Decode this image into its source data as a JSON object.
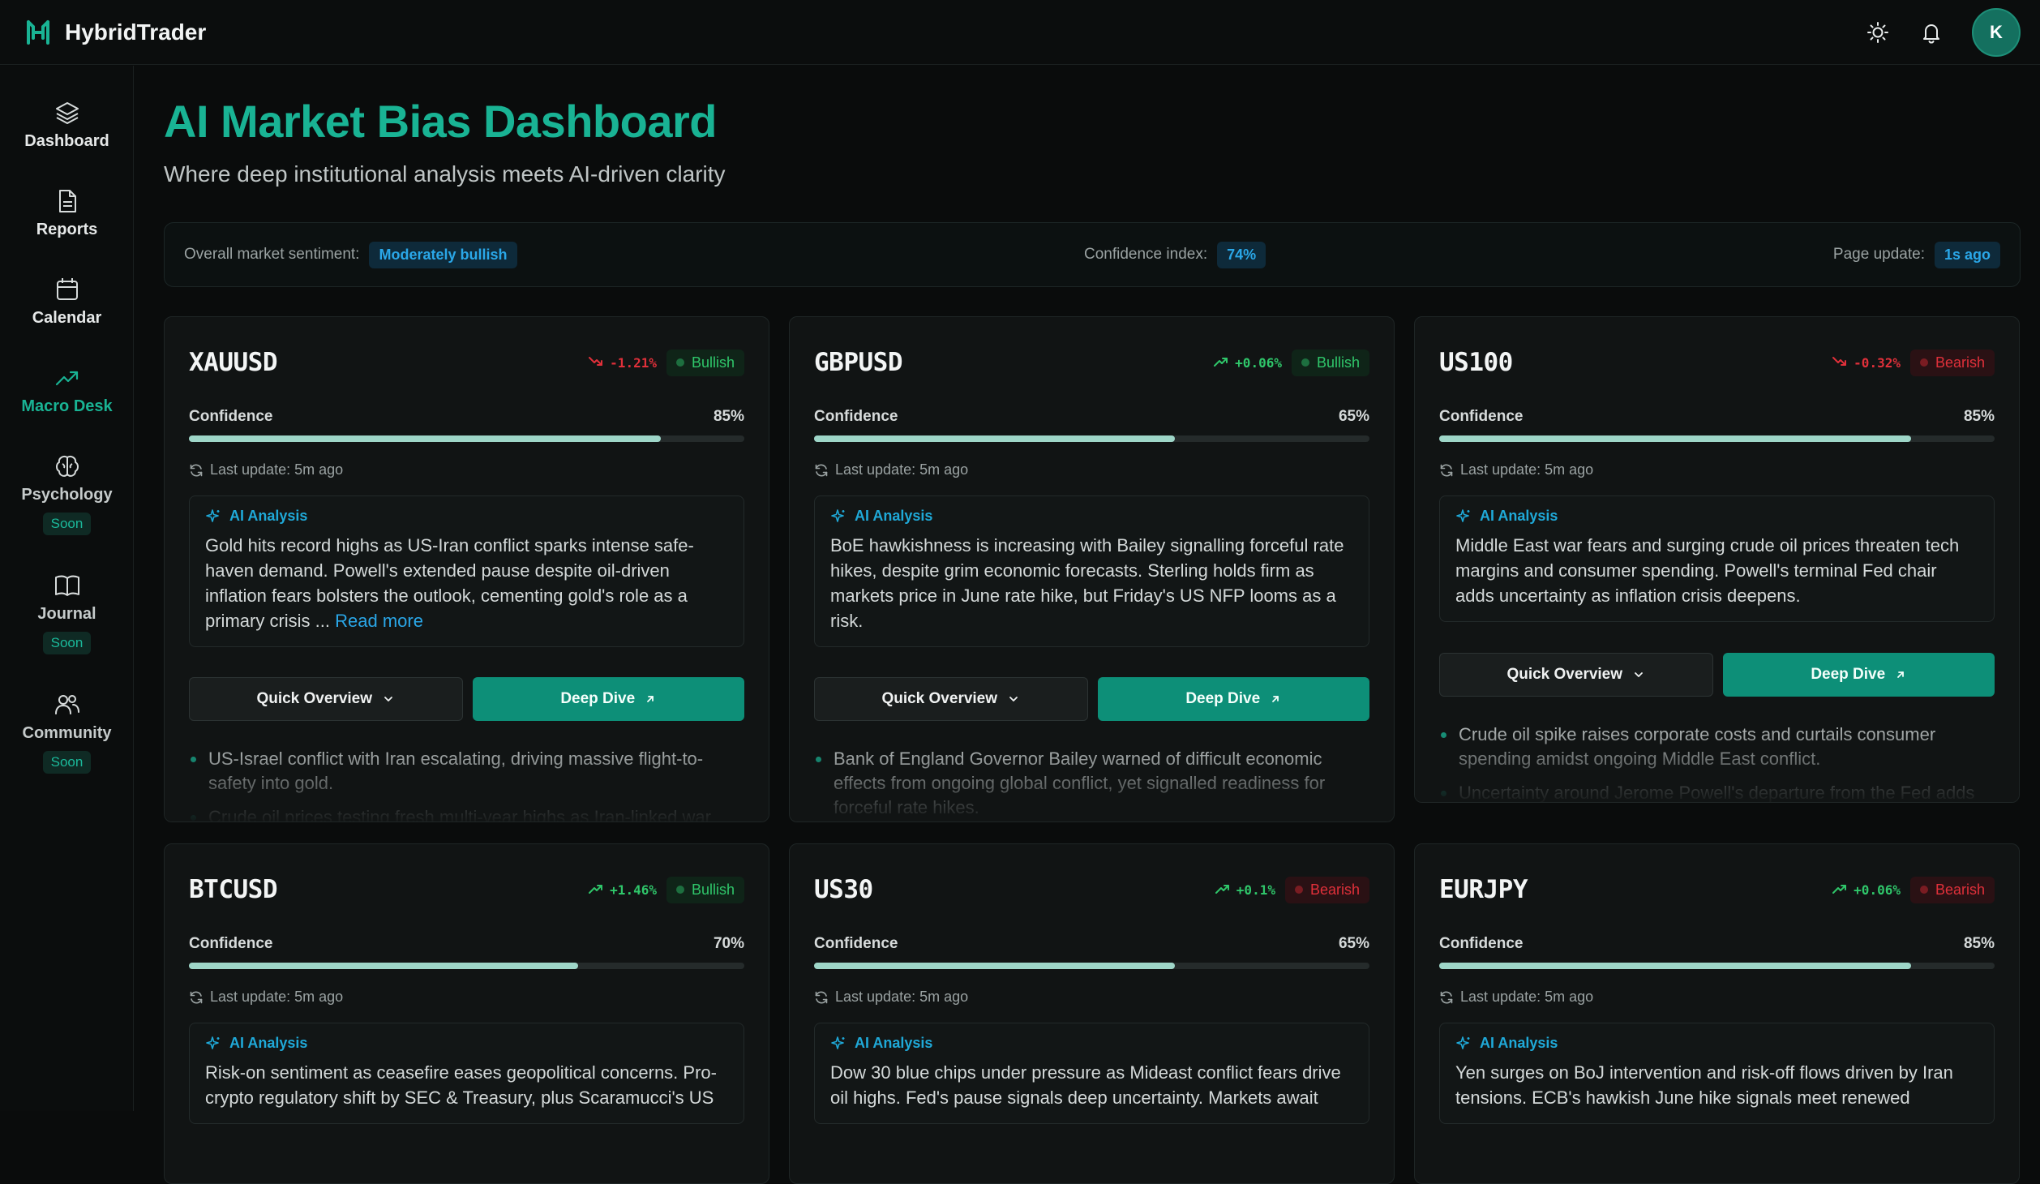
{
  "app": {
    "name": "HybridTrader",
    "avatar_initial": "K"
  },
  "topbar": {
    "icons": [
      "sun-icon",
      "bell-icon"
    ]
  },
  "sidebar": {
    "items": [
      {
        "label": "Dashboard",
        "icon": "layers-icon",
        "active": false,
        "soon": ""
      },
      {
        "label": "Reports",
        "icon": "document-icon",
        "active": false,
        "soon": ""
      },
      {
        "label": "Calendar",
        "icon": "calendar-icon",
        "active": false,
        "soon": ""
      },
      {
        "label": "Macro Desk",
        "icon": "trending-up-icon",
        "active": true,
        "soon": ""
      },
      {
        "label": "Psychology",
        "icon": "brain-icon",
        "active": false,
        "soon": "Soon"
      },
      {
        "label": "Journal",
        "icon": "book-icon",
        "active": false,
        "soon": "Soon"
      },
      {
        "label": "Community",
        "icon": "users-icon",
        "active": false,
        "soon": "Soon"
      }
    ]
  },
  "page": {
    "title": "AI Market Bias Dashboard",
    "subtitle": "Where deep institutional analysis meets AI-driven clarity"
  },
  "summary": {
    "sentiment_label": "Overall market sentiment:",
    "sentiment_value": "Moderately bullish",
    "confidence_label": "Confidence index:",
    "confidence_value": "74%",
    "update_label": "Page update:",
    "update_value": "1s ago"
  },
  "labels": {
    "confidence": "Confidence",
    "ai_analysis": "AI Analysis",
    "quick_overview": "Quick Overview",
    "deep_dive": "Deep Dive",
    "read_more": "Read more"
  },
  "cards": [
    {
      "symbol": "XAUUSD",
      "change": "-1.21%",
      "direction": "down",
      "bias": "Bullish",
      "confidence": 85,
      "confidence_text": "85%",
      "last_update": "Last update: 5m ago",
      "analysis": "Gold hits record highs as US-Iran conflict sparks intense safe-haven demand. Powell's extended pause despite oil-driven inflation fears bolsters the outlook, cementing gold's role as a primary crisis ...",
      "has_read_more": true,
      "bullets": [
        "US-Israel conflict with Iran escalating, driving massive flight-to-safety into gold.",
        "Crude oil prices testing fresh multi-year highs as Iran-linked war"
      ]
    },
    {
      "symbol": "GBPUSD",
      "change": "+0.06%",
      "direction": "up",
      "bias": "Bullish",
      "confidence": 65,
      "confidence_text": "65%",
      "last_update": "Last update: 5m ago",
      "analysis": "BoE hawkishness is increasing with Bailey signalling forceful rate hikes, despite grim economic forecasts. Sterling holds firm as markets price in June rate hike, but Friday's US NFP looms as a risk.",
      "has_read_more": false,
      "bullets": [
        "Bank of England Governor Bailey warned of difficult economic effects from ongoing global conflict, yet signalled readiness for forceful rate hikes."
      ]
    },
    {
      "symbol": "US100",
      "change": "-0.32%",
      "direction": "down",
      "bias": "Bearish",
      "confidence": 85,
      "confidence_text": "85%",
      "last_update": "Last update: 5m ago",
      "analysis": "Middle East war fears and surging crude oil prices threaten tech margins and consumer spending. Powell's terminal Fed chair adds uncertainty as inflation crisis deepens.",
      "has_read_more": false,
      "bullets": [
        "Crude oil spike raises corporate costs and curtails consumer spending amidst ongoing Middle East conflict.",
        "Uncertainty around Jerome Powell's departure from the Fed adds"
      ]
    },
    {
      "symbol": "BTCUSD",
      "change": "+1.46%",
      "direction": "up",
      "bias": "Bullish",
      "confidence": 70,
      "confidence_text": "70%",
      "last_update": "Last update: 5m ago",
      "analysis": "Risk-on sentiment as ceasefire eases geopolitical concerns. Pro-crypto regulatory shift by SEC & Treasury, plus Scaramucci's US",
      "has_read_more": false,
      "bullets": []
    },
    {
      "symbol": "US30",
      "change": "+0.1%",
      "direction": "up",
      "bias": "Bearish",
      "confidence": 65,
      "confidence_text": "65%",
      "last_update": "Last update: 5m ago",
      "analysis": "Dow 30 blue chips under pressure as Mideast conflict fears drive oil highs. Fed's pause signals deep uncertainty. Markets await",
      "has_read_more": false,
      "bullets": []
    },
    {
      "symbol": "EURJPY",
      "change": "+0.06%",
      "direction": "up",
      "bias": "Bearish",
      "confidence": 85,
      "confidence_text": "85%",
      "last_update": "Last update: 5m ago",
      "analysis": "Yen surges on BoJ intervention and risk-off flows driven by Iran tensions. ECB's hawkish June hike signals meet renewed",
      "has_read_more": false,
      "bullets": []
    }
  ],
  "colors": {
    "accent": "#19b394",
    "bullish": "#2fc66a",
    "bearish": "#e0303a",
    "info": "#2aa7e8"
  }
}
